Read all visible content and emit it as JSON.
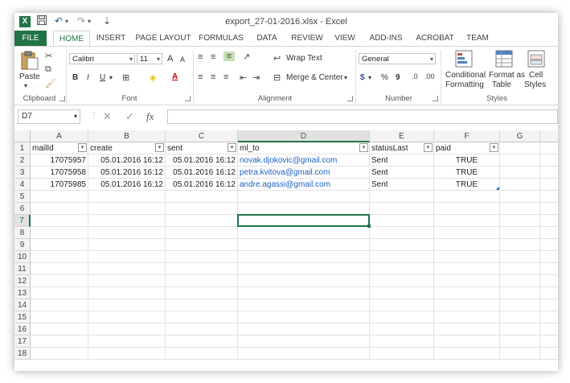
{
  "window": {
    "title": "export_27-01-2016.xlsx - Excel",
    "app_icon": "X"
  },
  "qat": {
    "save_icon": "floppy-icon",
    "undo": "↶",
    "redo": "↷",
    "customize": "⇣"
  },
  "tabs": [
    "FILE",
    "HOME",
    "INSERT",
    "PAGE LAYOUT",
    "FORMULAS",
    "DATA",
    "REVIEW",
    "VIEW",
    "ADD-INS",
    "ACROBAT",
    "TEAM"
  ],
  "ribbon": {
    "clipboard": {
      "paste": "Paste",
      "label": "Clipboard"
    },
    "font": {
      "name": "Calibri",
      "size": "11",
      "grow": "A",
      "shrink": "A",
      "bold": "B",
      "italic": "I",
      "underline": "U",
      "font_color_glyph": "A",
      "label": "Font"
    },
    "alignment": {
      "wrap": "Wrap Text",
      "merge": "Merge & Center",
      "label": "Alignment"
    },
    "number": {
      "format": "General",
      "currency": "$",
      "percent": "%",
      "comma": "9",
      "label": "Number"
    },
    "styles": {
      "conditional_1": "Conditional",
      "conditional_2": "Formatting",
      "table_1": "Format as",
      "table_2": "Table",
      "cell_1": "Cell",
      "cell_2": "Styles",
      "label": "Styles"
    }
  },
  "formula_bar": {
    "name_box": "D7",
    "fx": "fx",
    "cancel": "✕",
    "confirm": "✓",
    "value": ""
  },
  "columns": [
    "A",
    "B",
    "C",
    "D",
    "E",
    "F",
    "G"
  ],
  "rows": [
    "1",
    "2",
    "3",
    "4",
    "5",
    "6",
    "7",
    "8",
    "9",
    "10",
    "11",
    "12",
    "13",
    "14",
    "15",
    "16",
    "17",
    "18"
  ],
  "selected_cell": "D7",
  "table": {
    "headers": [
      "mailId",
      "create",
      "sent",
      "ml_to",
      "statusLast",
      "paid"
    ],
    "rows": [
      [
        "17075957",
        "05.01.2016 16:12",
        "05.01.2016 16:12",
        "novak.djokovic@gmail.com",
        "Sent",
        "TRUE"
      ],
      [
        "17075958",
        "05.01.2016 16:12",
        "05.01.2016 16:12",
        "petra.kvitova@gmail.com",
        "Sent",
        "TRUE"
      ],
      [
        "17075985",
        "05.01.2016 16:12",
        "05.01.2016 16:12",
        "andre.agassi@gmail.com",
        "Sent",
        "TRUE"
      ]
    ]
  },
  "colors": {
    "accent": "#217346",
    "link": "#1f5fbf"
  }
}
